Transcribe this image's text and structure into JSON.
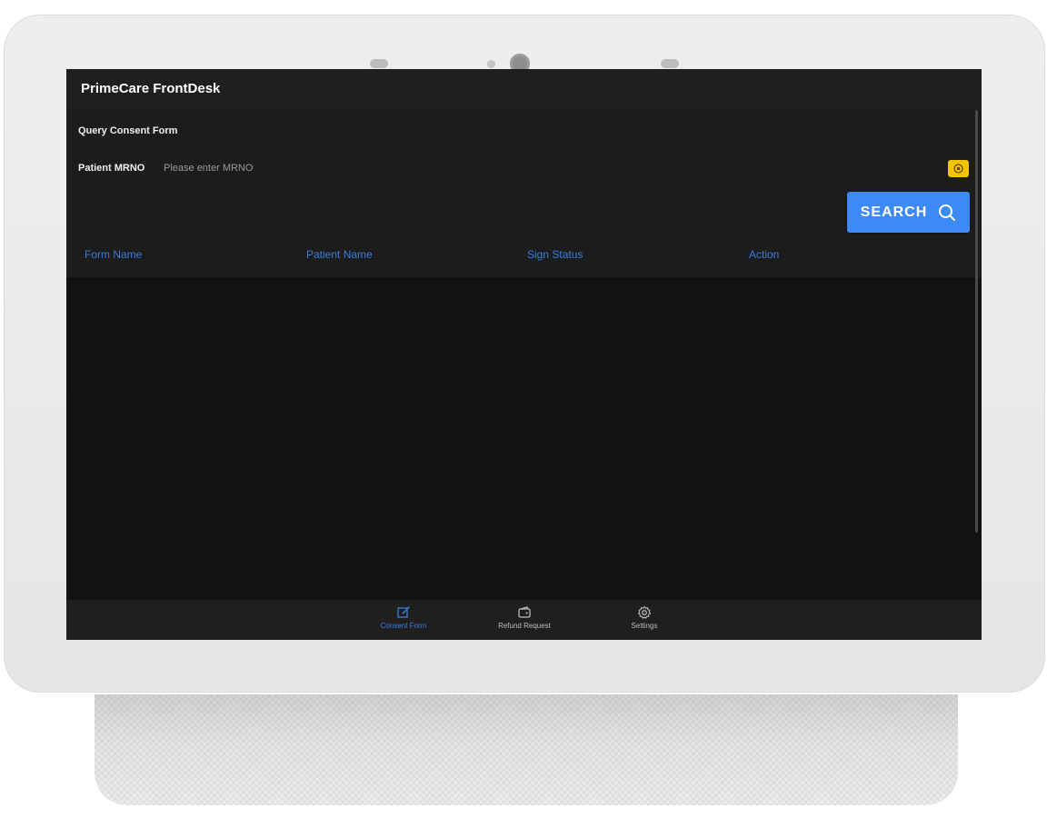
{
  "app": {
    "title": "PrimeCare FrontDesk"
  },
  "form": {
    "section_title": "Query Consent Form",
    "mrno_label": "Patient MRNO",
    "mrno_placeholder": "Please enter MRNO",
    "mrno_value": "",
    "search_label": "SEARCH"
  },
  "table": {
    "columns": [
      "Form Name",
      "Patient Name",
      "Sign Status",
      "Action"
    ],
    "rows": []
  },
  "bottom_nav": {
    "items": [
      {
        "label": "Consent Form",
        "icon": "edit-icon",
        "active": true
      },
      {
        "label": "Refund Request",
        "icon": "wallet-icon",
        "active": false
      },
      {
        "label": "Settings",
        "icon": "gear-icon",
        "active": false
      }
    ]
  },
  "colors": {
    "accent": "#3d8af7",
    "header_text": "#3a7de0",
    "scan_button": "#f5c400",
    "background": "#121212"
  }
}
